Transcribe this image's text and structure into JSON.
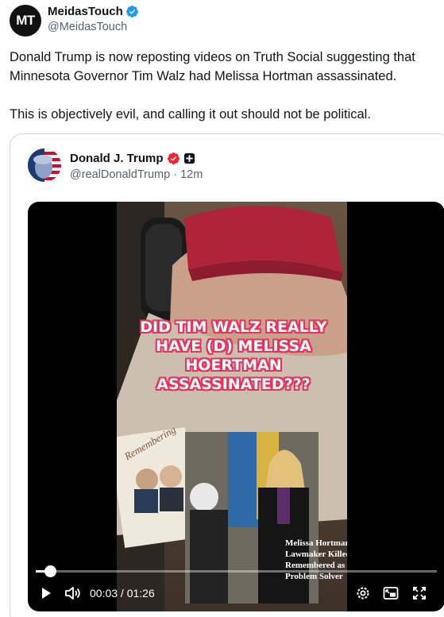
{
  "post": {
    "author_avatar_text": "MT",
    "author_name": "MeidasTouch",
    "author_handle": "@MeidasTouch",
    "paragraph1": "Donald Trump is now reposting videos on Truth Social suggesting that Minnesota Governor Tim Walz had Melissa Hortman assassinated.",
    "paragraph2": "This is objectively evil, and calling it out should not be political."
  },
  "quote": {
    "author_name": "Donald J. Trump",
    "author_handle": "@realDonaldTrump · 12m",
    "video": {
      "overlay_text": "DID TIM WALZ REALLY HAVE (D) MELISSA HOERTMAN ASSASSINATED???",
      "caption": "Melissa Hortman, Minnesota Lawmaker Killed in Shooting, Remembered as Pragmatic Problem Solver",
      "book_title": "Remembering",
      "time_current": "00:03",
      "time_total": "01:26",
      "progress_fraction": 0.035
    }
  },
  "colors": {
    "verified_blue": "#1d9bf0",
    "trump_badge": "#f4212e",
    "overlay_outline": "#e8325a",
    "handle_gray": "#536471"
  },
  "icons": [
    "verified-badge-icon",
    "play-icon",
    "volume-icon",
    "settings-icon",
    "picture-in-picture-icon",
    "fullscreen-icon"
  ]
}
